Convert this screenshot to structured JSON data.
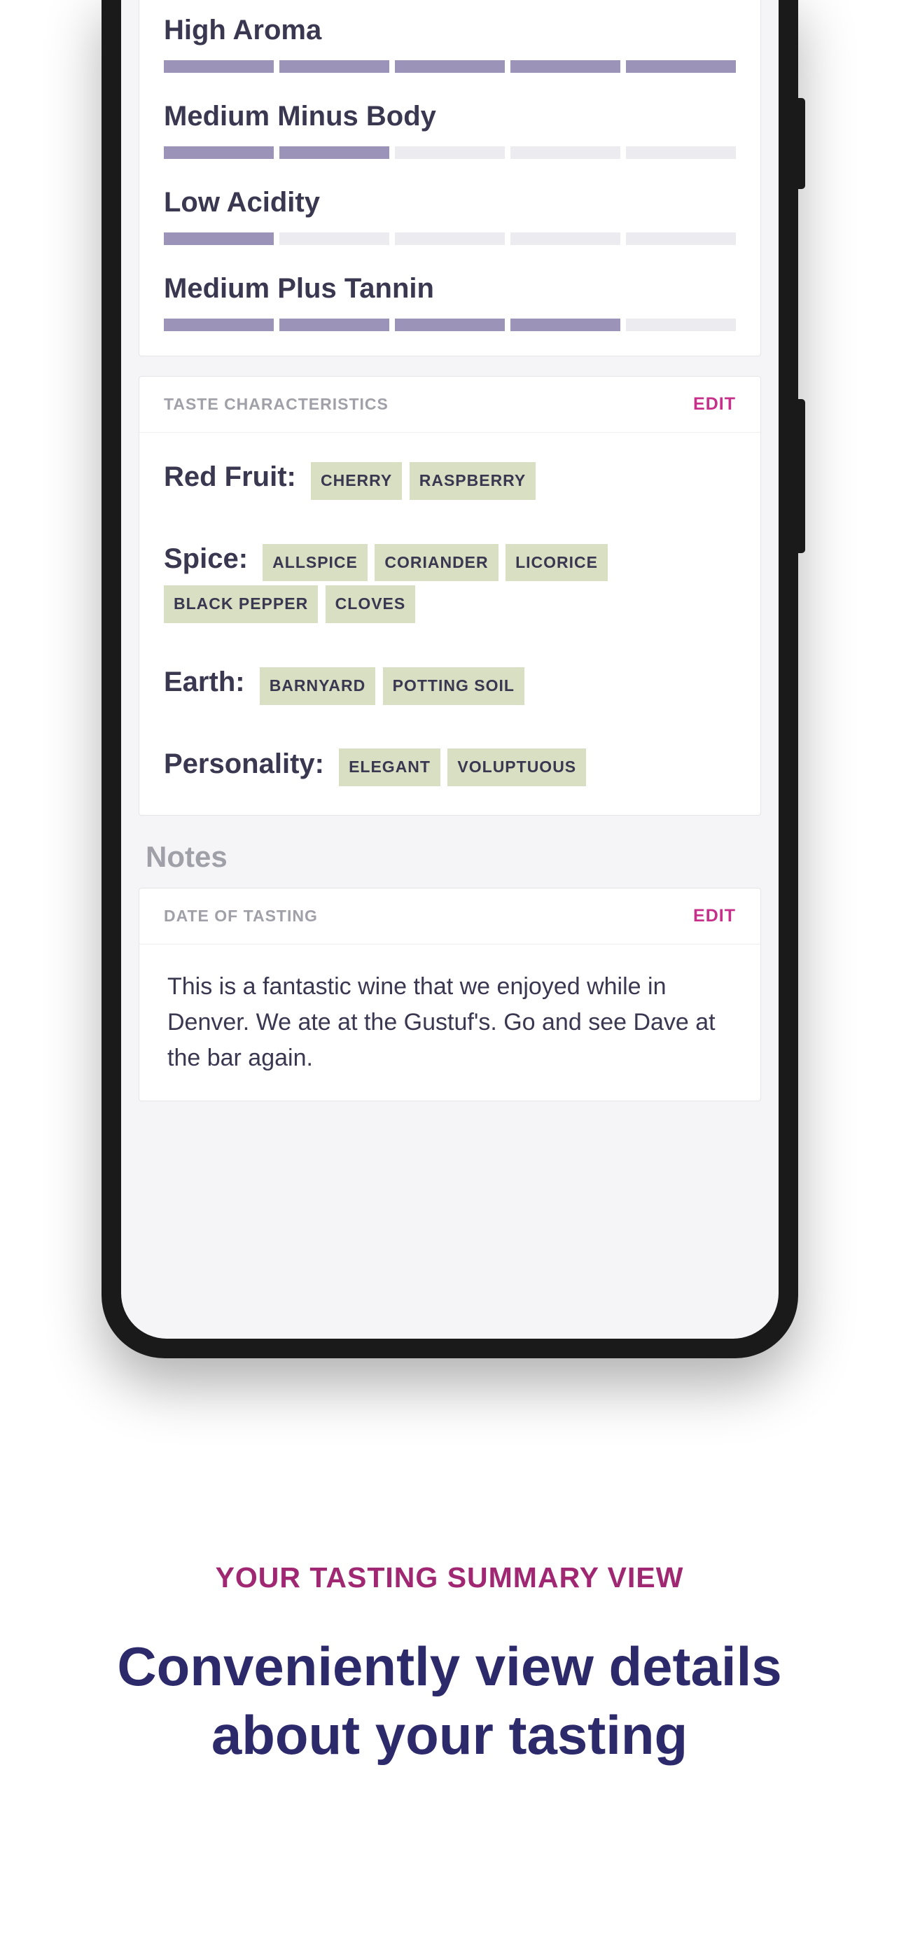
{
  "attributes": [
    {
      "label": "High Aroma",
      "filled": 5,
      "total": 5
    },
    {
      "label": "Medium Minus Body",
      "filled": 2,
      "total": 5
    },
    {
      "label": "Low Acidity",
      "filled": 1,
      "total": 5
    },
    {
      "label": "Medium Plus Tannin",
      "filled": 4,
      "total": 5
    }
  ],
  "taste": {
    "header": "TASTE CHARACTERISTICS",
    "edit": "EDIT",
    "rows": [
      {
        "label": "Red Fruit:",
        "tags": [
          "CHERRY",
          "RASPBERRY"
        ]
      },
      {
        "label": "Spice:",
        "tags": [
          "ALLSPICE",
          "CORIANDER",
          "LICORICE",
          "BLACK PEPPER",
          "CLOVES"
        ]
      },
      {
        "label": "Earth:",
        "tags": [
          "BARNYARD",
          "POTTING SOIL"
        ]
      },
      {
        "label": "Personality:",
        "tags": [
          "ELEGANT",
          "VOLUPTUOUS"
        ]
      }
    ]
  },
  "notes": {
    "title": "Notes",
    "header": "DATE OF TASTING",
    "edit": "EDIT",
    "body": "This is a fantastic wine that we enjoyed while in Denver. We ate at the Gustuf's. Go and see Dave at the bar again."
  },
  "marketing": {
    "eyebrow": "YOUR TASTING SUMMARY VIEW",
    "headline": "Conveniently view details about your tasting"
  }
}
